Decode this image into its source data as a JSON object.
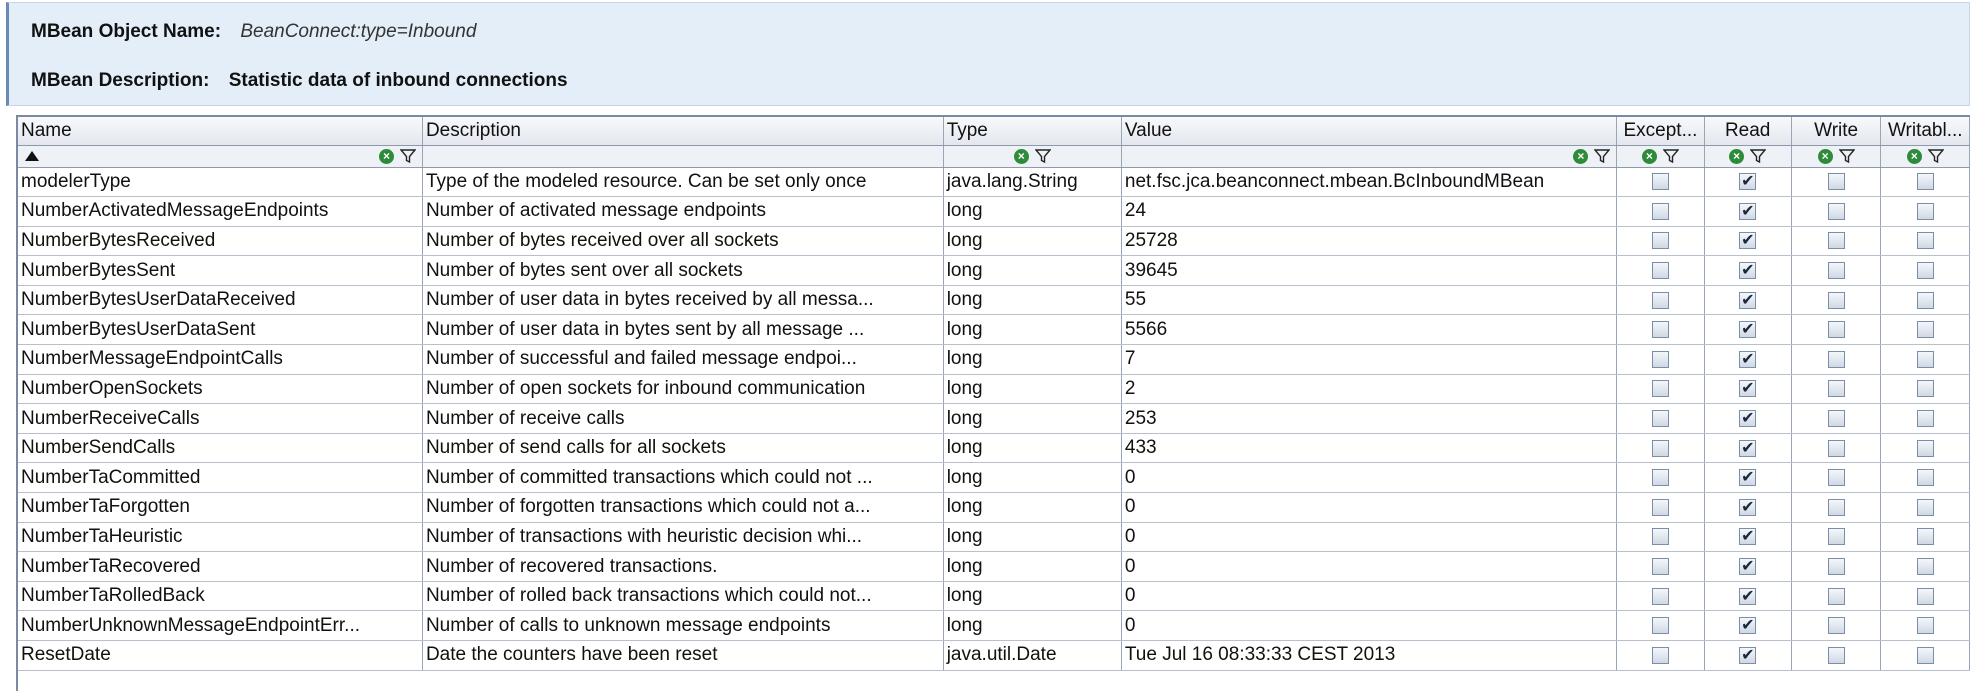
{
  "header": {
    "object_name_label": "MBean Object Name:",
    "object_name_value": "BeanConnect:type=Inbound",
    "description_label": "MBean Description:",
    "description_value": "Statistic data of inbound connections"
  },
  "table": {
    "columns": [
      "Name",
      "Description",
      "Type",
      "Value",
      "Except...",
      "Read",
      "Write",
      "Writabl..."
    ],
    "rows": [
      {
        "name": "modelerType",
        "description": "Type of the modeled resource. Can be set only once",
        "type": "java.lang.String",
        "value": "net.fsc.jca.beanconnect.mbean.BcInboundMBean",
        "except": false,
        "read": true,
        "write": false,
        "writable": false
      },
      {
        "name": "NumberActivatedMessageEndpoints",
        "description": "Number of activated message endpoints",
        "type": "long",
        "value": "24",
        "except": false,
        "read": true,
        "write": false,
        "writable": false
      },
      {
        "name": "NumberBytesReceived",
        "description": "Number of bytes received over all sockets",
        "type": "long",
        "value": "25728",
        "except": false,
        "read": true,
        "write": false,
        "writable": false
      },
      {
        "name": "NumberBytesSent",
        "description": "Number of bytes sent over all sockets",
        "type": "long",
        "value": "39645",
        "except": false,
        "read": true,
        "write": false,
        "writable": false
      },
      {
        "name": "NumberBytesUserDataReceived",
        "description": "Number of user data in bytes received by all messa...",
        "type": "long",
        "value": "55",
        "except": false,
        "read": true,
        "write": false,
        "writable": false
      },
      {
        "name": "NumberBytesUserDataSent",
        "description": "Number of user data in bytes sent by all message ...",
        "type": "long",
        "value": "5566",
        "except": false,
        "read": true,
        "write": false,
        "writable": false
      },
      {
        "name": "NumberMessageEndpointCalls",
        "description": "Number of successful and failed message endpoi...",
        "type": "long",
        "value": "7",
        "except": false,
        "read": true,
        "write": false,
        "writable": false
      },
      {
        "name": "NumberOpenSockets",
        "description": "Number of open sockets for inbound communication",
        "type": "long",
        "value": "2",
        "except": false,
        "read": true,
        "write": false,
        "writable": false
      },
      {
        "name": "NumberReceiveCalls",
        "description": "Number of receive calls",
        "type": "long",
        "value": "253",
        "except": false,
        "read": true,
        "write": false,
        "writable": false
      },
      {
        "name": "NumberSendCalls",
        "description": "Number of send calls for all sockets",
        "type": "long",
        "value": "433",
        "except": false,
        "read": true,
        "write": false,
        "writable": false
      },
      {
        "name": "NumberTaCommitted",
        "description": "Number of committed transactions which could not ...",
        "type": "long",
        "value": "0",
        "except": false,
        "read": true,
        "write": false,
        "writable": false
      },
      {
        "name": "NumberTaForgotten",
        "description": "Number of forgotten transactions which could not a...",
        "type": "long",
        "value": "0",
        "except": false,
        "read": true,
        "write": false,
        "writable": false
      },
      {
        "name": "NumberTaHeuristic",
        "description": "Number of transactions with heuristic decision whi...",
        "type": "long",
        "value": "0",
        "except": false,
        "read": true,
        "write": false,
        "writable": false
      },
      {
        "name": "NumberTaRecovered",
        "description": "Number of recovered transactions.",
        "type": "long",
        "value": "0",
        "except": false,
        "read": true,
        "write": false,
        "writable": false
      },
      {
        "name": "NumberTaRolledBack",
        "description": "Number of rolled back transactions which could not...",
        "type": "long",
        "value": "0",
        "except": false,
        "read": true,
        "write": false,
        "writable": false
      },
      {
        "name": "NumberUnknownMessageEndpointErr...",
        "description": "Number of calls to unknown message endpoints",
        "type": "long",
        "value": "0",
        "except": false,
        "read": true,
        "write": false,
        "writable": false
      },
      {
        "name": "ResetDate",
        "description": "Date the counters have been reset",
        "type": "java.util.Date",
        "value": "Tue Jul 16 08:33:33 CEST 2013",
        "except": false,
        "read": true,
        "write": false,
        "writable": false
      }
    ]
  },
  "icons": {
    "sort": "sort-ascending-icon",
    "clear_filter": "clear-filter-icon",
    "filter": "funnel-icon"
  },
  "colors": {
    "header_bg": "#e3eef9",
    "filter_clear_green": "#2e8b3a"
  }
}
